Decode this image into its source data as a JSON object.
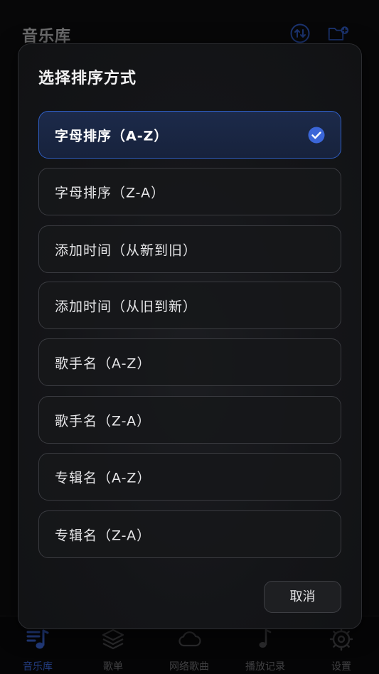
{
  "header": {
    "title": "音乐库",
    "sort_icon": "sort-arrows-icon",
    "new_folder_icon": "folder-add-icon"
  },
  "modal": {
    "title": "选择排序方式",
    "options": [
      {
        "label": "字母排序（A-Z）",
        "selected": true
      },
      {
        "label": "字母排序（Z-A）",
        "selected": false
      },
      {
        "label": "添加时间（从新到旧）",
        "selected": false
      },
      {
        "label": "添加时间（从旧到新）",
        "selected": false
      },
      {
        "label": "歌手名（A-Z）",
        "selected": false
      },
      {
        "label": "歌手名（Z-A）",
        "selected": false
      },
      {
        "label": "专辑名（A-Z）",
        "selected": false
      },
      {
        "label": "专辑名（Z-A）",
        "selected": false
      }
    ],
    "cancel_label": "取消"
  },
  "nav": {
    "items": [
      {
        "label": "音乐库",
        "icon": "library-icon",
        "active": true
      },
      {
        "label": "歌单",
        "icon": "layers-icon",
        "active": false
      },
      {
        "label": "网络歌曲",
        "icon": "cloud-icon",
        "active": false
      },
      {
        "label": "播放记录",
        "icon": "music-note-icon",
        "active": false
      },
      {
        "label": "设置",
        "icon": "gear-icon",
        "active": false
      }
    ]
  },
  "colors": {
    "accent": "#3b66d8",
    "selected_bg": "#1c2a4a",
    "background": "#0d0d0e"
  }
}
